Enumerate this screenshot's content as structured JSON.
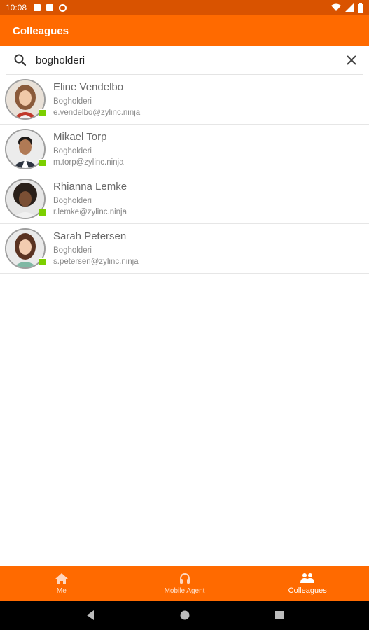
{
  "status_bar": {
    "time": "10:08"
  },
  "app_bar": {
    "title": "Colleagues"
  },
  "search": {
    "value": "bogholderi",
    "placeholder": ""
  },
  "colleagues": [
    {
      "name": "Eline Vendelbo",
      "department": "Bogholderi",
      "email": "e.vendelbo@zylinc.ninja",
      "presence": "available"
    },
    {
      "name": "Mikael Torp",
      "department": "Bogholderi",
      "email": "m.torp@zylinc.ninja",
      "presence": "available"
    },
    {
      "name": "Rhianna Lemke",
      "department": "Bogholderi",
      "email": "r.lemke@zylinc.ninja",
      "presence": "available"
    },
    {
      "name": "Sarah Petersen",
      "department": "Bogholderi",
      "email": "s.petersen@zylinc.ninja",
      "presence": "available"
    }
  ],
  "bottom_nav": {
    "items": [
      {
        "label": "Me",
        "icon": "home-icon"
      },
      {
        "label": "Mobile Agent",
        "icon": "headset-icon"
      },
      {
        "label": "Colleagues",
        "icon": "people-icon",
        "active": true
      }
    ]
  },
  "colors": {
    "primary": "#ff6a00",
    "status_bar": "#d95300",
    "presence_available": "#7ccf00"
  }
}
